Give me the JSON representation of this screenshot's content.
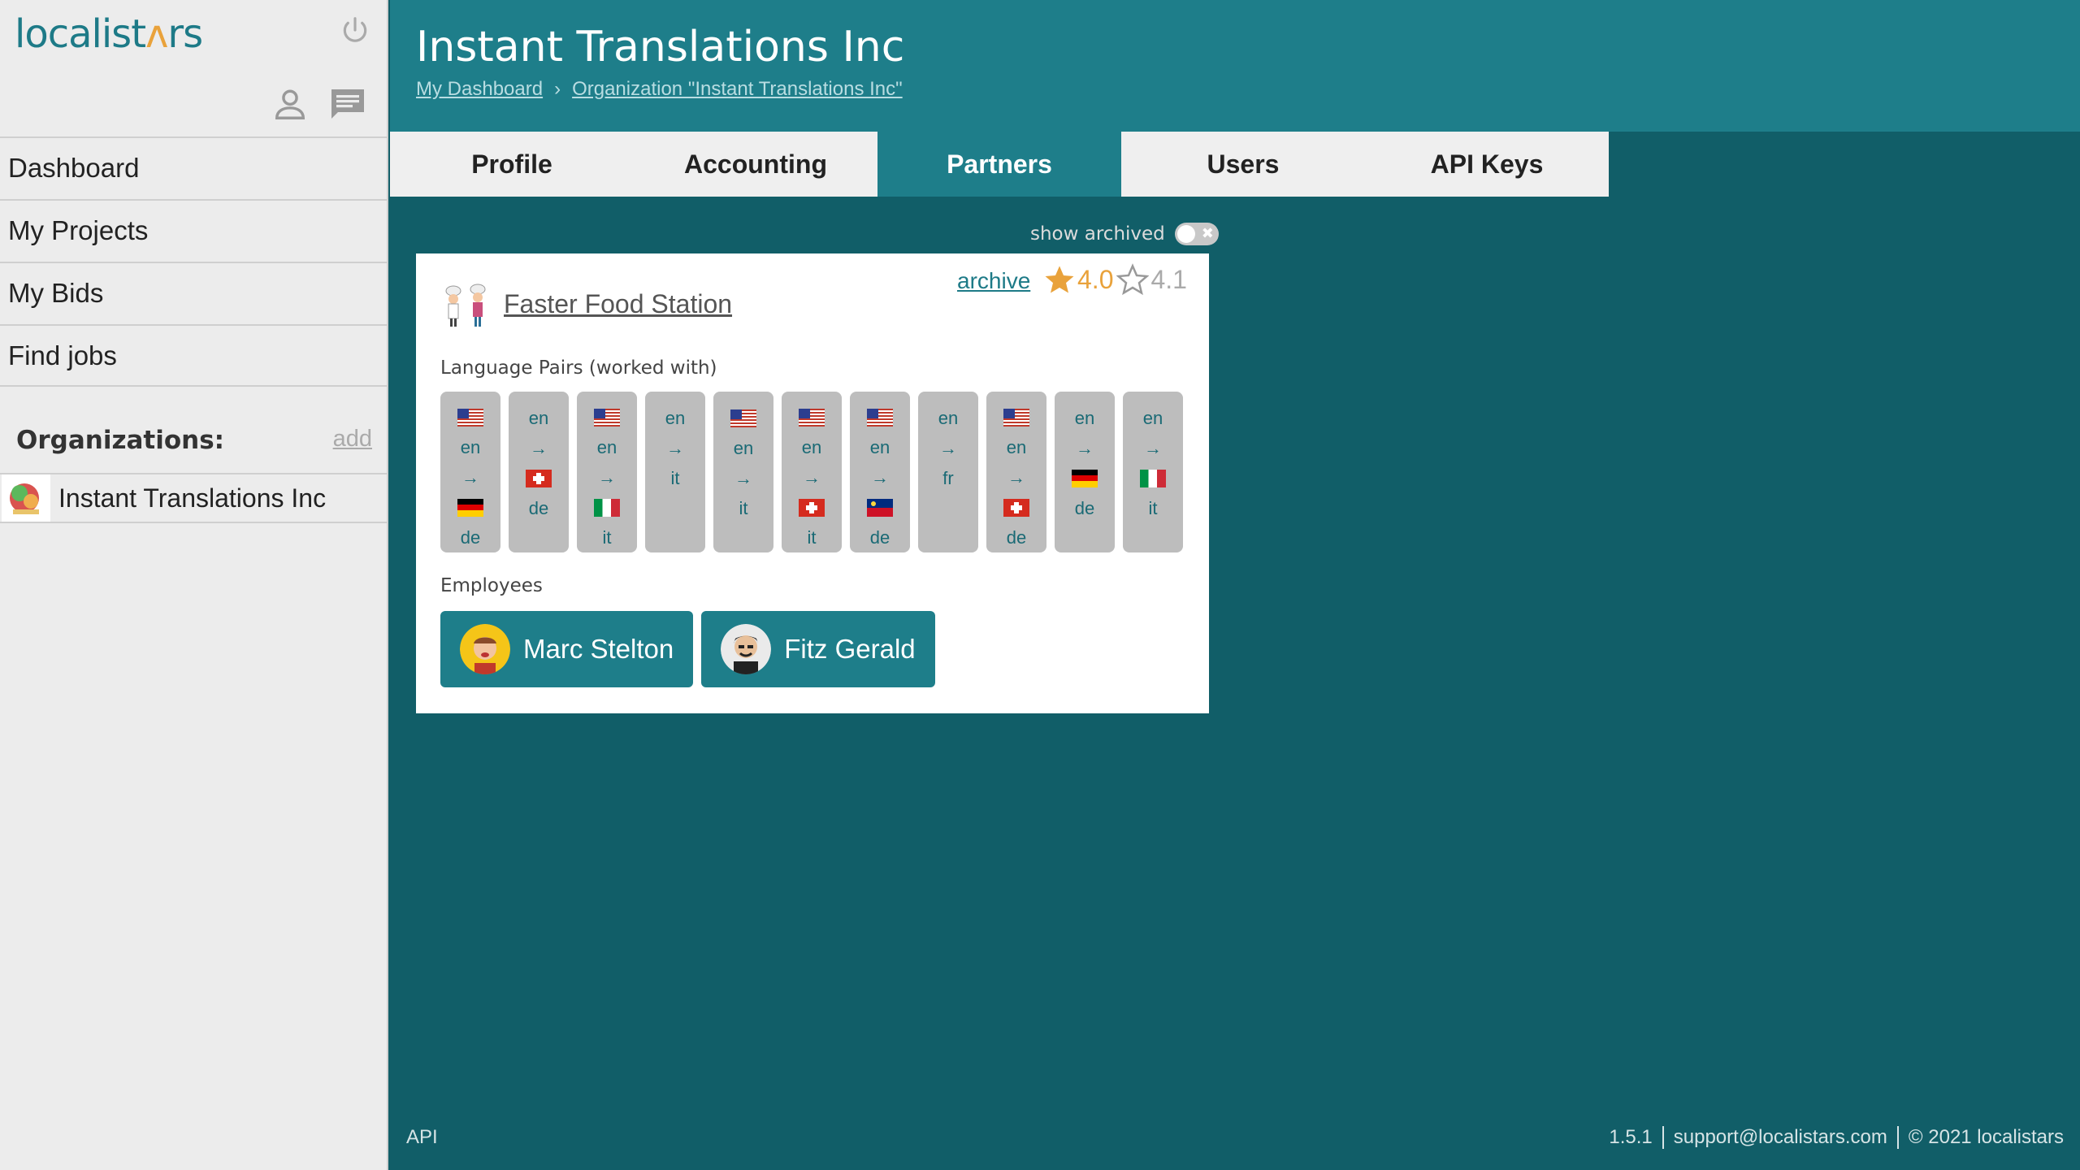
{
  "app": {
    "logo_text_1": "localist",
    "logo_text_2": "rs",
    "logo_accent": "ʌ"
  },
  "sidebar": {
    "nav": [
      {
        "label": "Dashboard"
      },
      {
        "label": "My Projects"
      },
      {
        "label": "My Bids"
      },
      {
        "label": "Find jobs"
      }
    ],
    "organizations_label": "Organizations:",
    "add_label": "add",
    "organization": {
      "name": "Instant Translations Inc"
    }
  },
  "header": {
    "title": "Instant Translations Inc",
    "breadcrumb": [
      {
        "label": "My Dashboard"
      },
      {
        "label": "Organization \"Instant Translations Inc\""
      }
    ],
    "breadcrumb_sep": "›"
  },
  "tabs": [
    {
      "label": "Profile",
      "active": false
    },
    {
      "label": "Accounting",
      "active": false
    },
    {
      "label": "Partners",
      "active": true
    },
    {
      "label": "Users",
      "active": false
    },
    {
      "label": "API Keys",
      "active": false
    }
  ],
  "filters": {
    "show_archived_label": "show archived",
    "show_archived": false,
    "toggle_glyph": "✖"
  },
  "partner": {
    "name": "Faster Food Station",
    "archive_label": "archive",
    "rating_1": "4.0",
    "rating_2": "4.1",
    "language_pairs_label": "Language Pairs (worked with)",
    "arrow": "→",
    "language_pairs": [
      {
        "src_flag": "us",
        "src": "en",
        "tgt_flag": "de",
        "tgt": "de"
      },
      {
        "src_flag": null,
        "src": "en",
        "tgt_flag": "ch",
        "tgt": "de"
      },
      {
        "src_flag": "us",
        "src": "en",
        "tgt_flag": "it",
        "tgt": "it"
      },
      {
        "src_flag": null,
        "src": "en",
        "tgt_flag": null,
        "tgt": "it"
      },
      {
        "src_flag": "us",
        "src": "en",
        "tgt_flag": null,
        "tgt": "it"
      },
      {
        "src_flag": "us",
        "src": "en",
        "tgt_flag": "ch",
        "tgt": "it"
      },
      {
        "src_flag": "us",
        "src": "en",
        "tgt_flag": "li",
        "tgt": "de"
      },
      {
        "src_flag": null,
        "src": "en",
        "tgt_flag": null,
        "tgt": "fr"
      },
      {
        "src_flag": "us",
        "src": "en",
        "tgt_flag": "ch",
        "tgt": "de"
      },
      {
        "src_flag": null,
        "src": "en",
        "tgt_flag": "de",
        "tgt": "de"
      },
      {
        "src_flag": null,
        "src": "en",
        "tgt_flag": "it",
        "tgt": "it"
      }
    ],
    "employees_label": "Employees",
    "employees": [
      {
        "name": "Marc Stelton"
      },
      {
        "name": "Fitz Gerald"
      }
    ]
  },
  "footer": {
    "api_label": "API",
    "version": "1.5.1",
    "support_email": "support@localistars.com",
    "copyright": "© 2021 localistars"
  },
  "colors": {
    "brand_teal": "#1e7e8a",
    "background": "#115e68",
    "accent_orange": "#e9a23b"
  }
}
